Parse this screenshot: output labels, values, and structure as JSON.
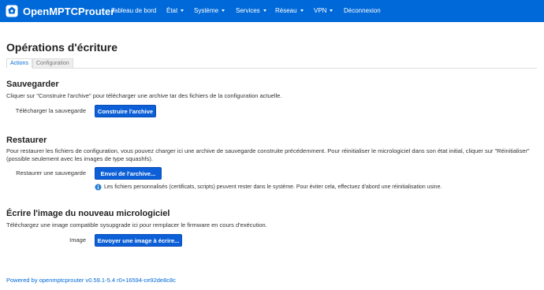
{
  "app": {
    "brand": "OpenMPTCProuter",
    "logo_icon": "openmptcprouter-logo-icon"
  },
  "nav": {
    "items": [
      {
        "label": "Tableau de bord",
        "dropdown": false
      },
      {
        "label": "État",
        "dropdown": true
      },
      {
        "label": "Système",
        "dropdown": true
      },
      {
        "label": "Services",
        "dropdown": true
      },
      {
        "label": "Réseau",
        "dropdown": true
      },
      {
        "label": "VPN",
        "dropdown": true
      },
      {
        "label": "Déconnexion",
        "dropdown": false
      }
    ]
  },
  "page": {
    "title": "Opérations d'écriture",
    "tabs": [
      {
        "label": "Actions",
        "active": true
      },
      {
        "label": "Configuration",
        "active": false
      }
    ]
  },
  "backup": {
    "heading": "Sauvegarder",
    "description": "Cliquer sur \"Construire l'archive\" pour télécharger une archive tar des fichiers de la configuration actuelle.",
    "label": "Télécharger la sauvegarde",
    "button": "Construire l'archive"
  },
  "restore": {
    "heading": "Restaurer",
    "description": "Pour restaurer les fichiers de configuration, vous pouvez charger ici une archive de sauvegarde construite précédemment. Pour réinitialiser le micrologiciel dans son état initial, cliquer sur \"Réinitialiser\" (possible seulement avec les images de type squashfs).",
    "label": "Restaurer une sauvegarde",
    "button": "Envoi de l'archive...",
    "hint": "Les fichiers personnalisés (certificats, scripts) peuvent rester dans le système. Pour éviter cela, effectuez d'abord une réinitialisation usine.",
    "hint_icon": "info-icon"
  },
  "flash": {
    "heading": "Écrire l'image du nouveau micrologiciel",
    "description": "Téléchargez une image compatible sysupgrade ici pour remplacer le firmware en cours d'exécution.",
    "label": "Image",
    "button": "Envoyer une image à écrire..."
  },
  "footer": {
    "text": "Powered by openmptcprouter v0.59.1-5.4 r0+16594-ce92de8c8c"
  },
  "colors": {
    "navbar": "#0069d9",
    "button": "#0c5fd6",
    "link": "#0069d9"
  }
}
